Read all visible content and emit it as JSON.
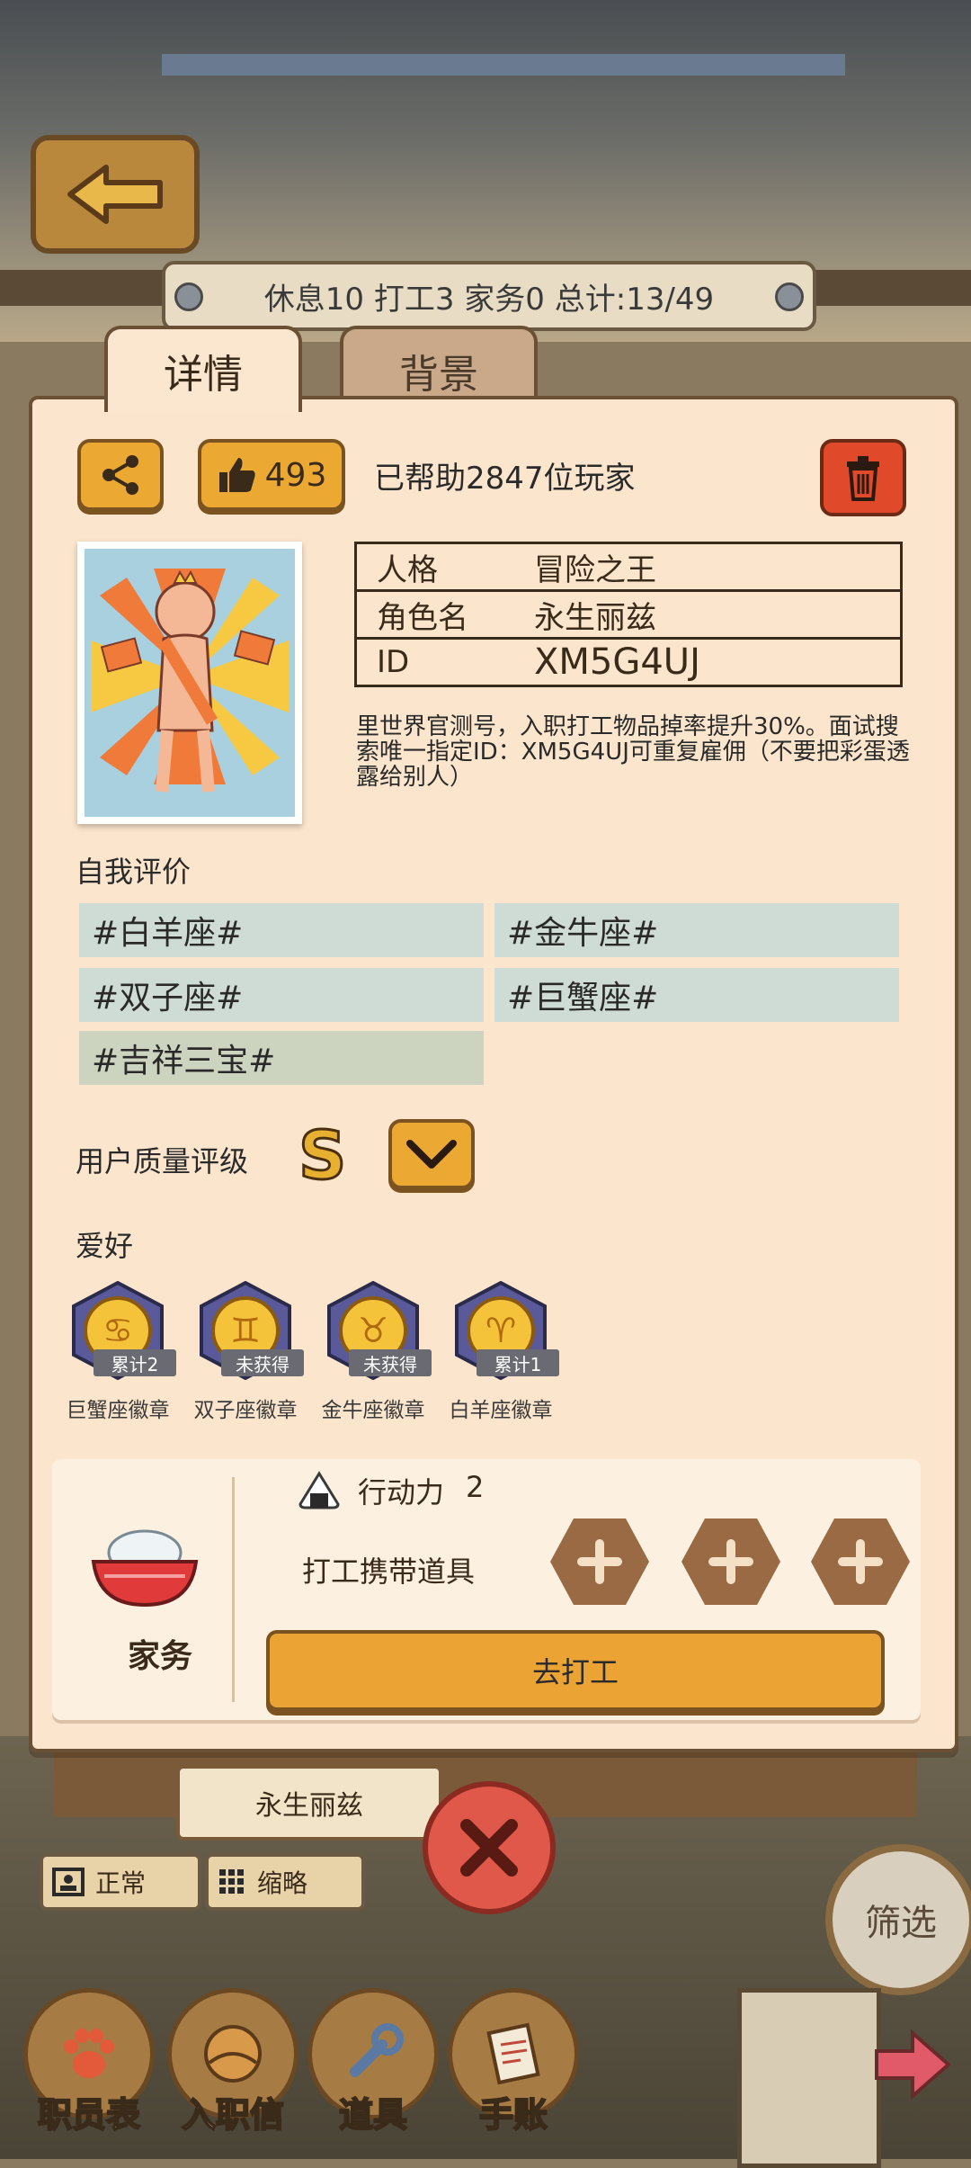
{
  "header": {
    "stats_text": "休息10 打工3 家务0 总计:13/49"
  },
  "tabs": [
    {
      "label": "详情",
      "active": true
    },
    {
      "label": "背景",
      "active": false
    }
  ],
  "detail": {
    "like_count": "493",
    "help_text": "已帮助2847位玩家",
    "info": [
      {
        "key": "人格",
        "value": "冒险之王"
      },
      {
        "key": "角色名",
        "value": "永生丽兹"
      },
      {
        "key": "ID",
        "value": "XM5G4UJ"
      }
    ],
    "description": "里世界官测号，入职打工物品掉率提升30%。面试搜索唯一指定ID：XM5G4UJ可重复雇佣（不要把彩蛋透露给别人）",
    "self_eval_label": "自我评价",
    "tags": [
      "#白羊座#",
      "#金牛座#",
      "#双子座#",
      "#巨蟹座#",
      "#吉祥三宝#"
    ],
    "quality_label": "用户质量评级",
    "quality_grade": "S",
    "hobby_label": "爱好",
    "badges": [
      {
        "chip": "累计2",
        "name": "巨蟹座徽章"
      },
      {
        "chip": "未获得",
        "name": "双子座徽章"
      },
      {
        "chip": "未获得",
        "name": "金牛座徽章"
      },
      {
        "chip": "累计1",
        "name": "白羊座徽章"
      }
    ]
  },
  "work_panel": {
    "chores_label": "家务",
    "action_label": "行动力",
    "action_value": "2",
    "tools_label": "打工携带道具",
    "go_work_label": "去打工"
  },
  "bottom": {
    "nameplate": "永生丽兹",
    "mode_normal": "正常",
    "mode_compact": "缩略",
    "filter_label": "筛选",
    "nav": [
      "职员表",
      "入职信",
      "道具",
      "手账"
    ]
  },
  "colors": {
    "card_bg": "#fbe5cc",
    "accent_orange": "#eba934",
    "danger_red": "#e04a2a",
    "tag_teal": "#cfdcd6"
  }
}
